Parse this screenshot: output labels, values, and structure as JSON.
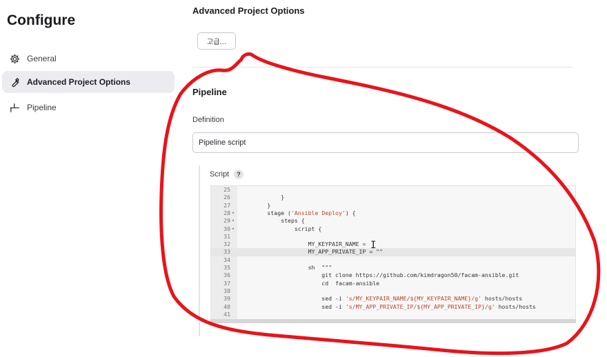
{
  "sidebar": {
    "title": "Configure",
    "items": [
      {
        "label": "General",
        "icon": "gear-icon"
      },
      {
        "label": "Advanced Project Options",
        "icon": "wrench-icon"
      },
      {
        "label": "Pipeline",
        "icon": "pipeline-icon"
      }
    ]
  },
  "main": {
    "advanced_section_title": "Advanced Project Options",
    "advanced_button_label": "고급...",
    "pipeline_section_title": "Pipeline",
    "definition_label": "Definition",
    "definition_value": "Pipeline script",
    "script_label": "Script",
    "help_label": "?"
  },
  "editor": {
    "highlighted_line": "33",
    "lines": [
      {
        "n": "25",
        "fold": "",
        "code": "        "
      },
      {
        "n": "26",
        "fold": "",
        "code": "            }"
      },
      {
        "n": "27",
        "fold": "",
        "code": "        }"
      },
      {
        "n": "28",
        "fold": "▾",
        "code": "        stage ('Ansible Deploy') {"
      },
      {
        "n": "29",
        "fold": "▾",
        "code": "            steps {"
      },
      {
        "n": "30",
        "fold": "▾",
        "code": "                script {"
      },
      {
        "n": "31",
        "fold": "",
        "code": ""
      },
      {
        "n": "32",
        "fold": "",
        "code": "                    MY_KEYPAIR_NAME = "
      },
      {
        "n": "33",
        "fold": "",
        "code": "                    MY_APP_PRIVATE_IP = \"\""
      },
      {
        "n": "34",
        "fold": "",
        "code": ""
      },
      {
        "n": "35",
        "fold": "",
        "code": "                    sh  \"\"\""
      },
      {
        "n": "36",
        "fold": "",
        "code": "                        git clone https://github.com/kimdragon50/facam-ansible.git"
      },
      {
        "n": "37",
        "fold": "",
        "code": "                        cd  facam-ansible"
      },
      {
        "n": "38",
        "fold": "",
        "code": ""
      },
      {
        "n": "39",
        "fold": "",
        "code": "                        sed -i 's/MY_KEYPAIR_NAME/${MY_KEYPAIR_NAME}/g' hosts/hosts"
      },
      {
        "n": "40",
        "fold": "",
        "code": "                        sed -i 's/MY_APP_PRIVATE_IP/${MY_APP_PRIVATE_IP}/g' hosts/hosts"
      },
      {
        "n": "41",
        "fold": "",
        "code": ""
      }
    ]
  },
  "colors": {
    "active_nav_bg": "#ececf0",
    "annotation": "#e8141a"
  }
}
